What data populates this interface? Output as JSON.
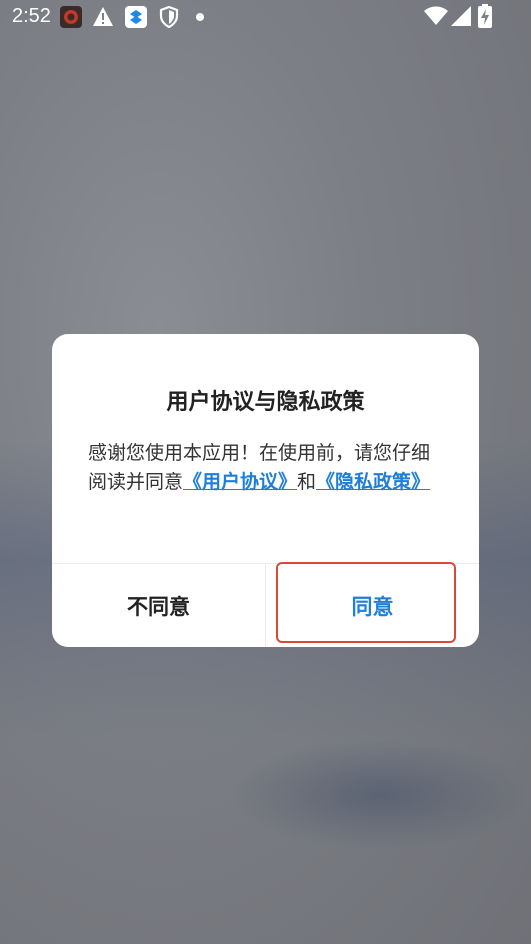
{
  "status_bar": {
    "time": "2:52",
    "icons": [
      "app-notification-icon",
      "warning-icon",
      "dropbox-icon",
      "shield-icon",
      "dot-icon",
      "wifi-icon",
      "signal-icon",
      "battery-charging-icon"
    ]
  },
  "dialog": {
    "title": "用户协议与隐私政策",
    "body_prefix": "感谢您使用本应用！在使用前，请您仔细阅读并同意",
    "user_agreement_link": "《用户协议》",
    "connector": "和",
    "privacy_policy_link": "《隐私政策》",
    "disagree_label": "不同意",
    "agree_label": "同意"
  },
  "colors": {
    "accent": "#1e7fd8",
    "highlight_border": "#d84a38",
    "overlay": "#7c7f85"
  }
}
